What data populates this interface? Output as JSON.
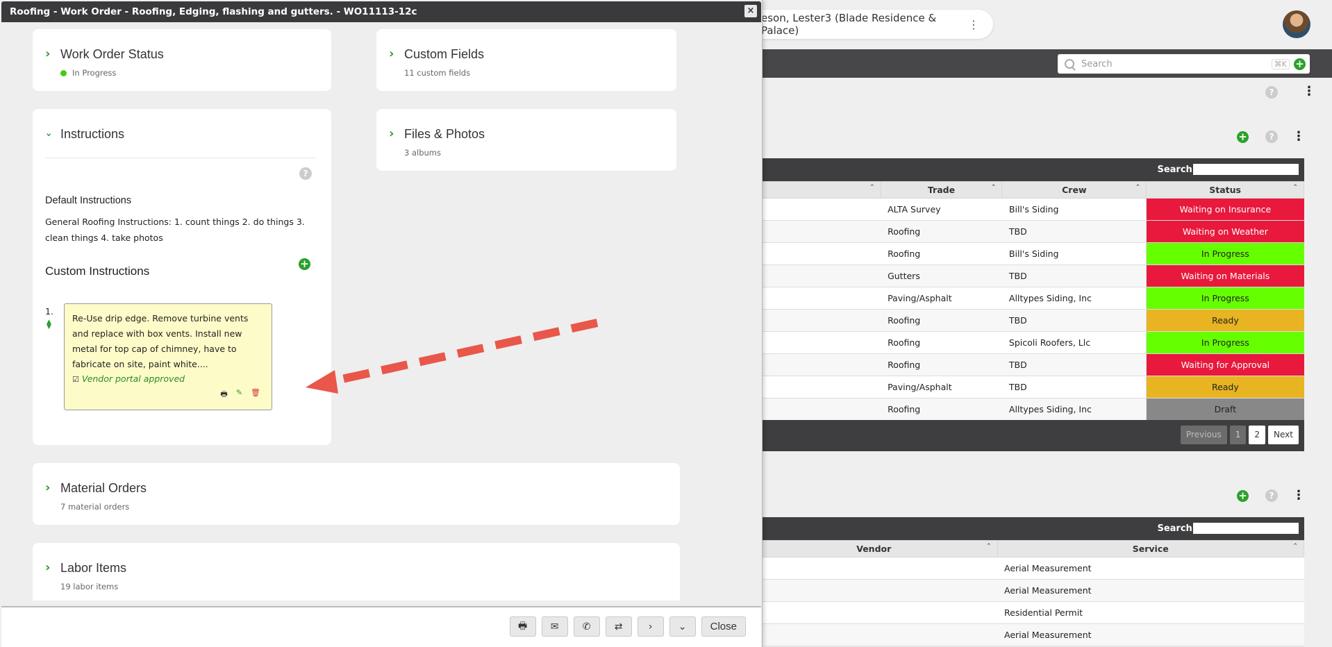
{
  "background": {
    "contact_name": "eson, Lester3 (Blade Residence & Palace)",
    "search": {
      "placeholder": "Search",
      "shortcut": "⌘K"
    },
    "table1": {
      "search_label": "Search:",
      "columns": [
        "",
        "Trade",
        "Crew",
        "Status"
      ],
      "rows": [
        {
          "trade": "ALTA Survey",
          "crew": "Bill's Siding",
          "status": "Waiting on Insurance",
          "color": "#e8193c"
        },
        {
          "trade": "Roofing",
          "crew": "TBD",
          "status": "Waiting on Weather",
          "color": "#e8193c"
        },
        {
          "trade": "Roofing",
          "crew": "Bill's Siding",
          "status": "In Progress",
          "color": "#66ff00"
        },
        {
          "trade": "Gutters",
          "crew": "TBD",
          "status": "Waiting on Materials",
          "color": "#e8193c"
        },
        {
          "trade": "Paving/Asphalt",
          "crew": "Alltypes Siding, Inc",
          "status": "In Progress",
          "color": "#66ff00"
        },
        {
          "trade": "Roofing",
          "crew": "TBD",
          "status": "Ready",
          "color": "#e8b422"
        },
        {
          "trade": "Roofing",
          "crew": "Spicoli Roofers, Llc",
          "status": "In Progress",
          "color": "#66ff00"
        },
        {
          "trade": "Roofing",
          "crew": "TBD",
          "status": "Waiting for Approval",
          "color": "#e8193c"
        },
        {
          "trade": "Paving/Asphalt",
          "crew": "TBD",
          "status": "Ready",
          "color": "#e8b422"
        },
        {
          "trade": "Roofing",
          "crew": "Alltypes Siding, Inc",
          "status": "Draft",
          "color": "#888888"
        }
      ],
      "pager": {
        "previous": "Previous",
        "page1": "1",
        "page2": "2",
        "next": "Next"
      }
    },
    "table2": {
      "search_label": "Search:",
      "columns": [
        "Vendor",
        "Service"
      ],
      "rows": [
        {
          "service": "Aerial Measurement"
        },
        {
          "service": "Aerial Measurement"
        },
        {
          "service": "Residential Permit"
        },
        {
          "service": "Aerial Measurement"
        }
      ]
    }
  },
  "modal": {
    "title": "Roofing - Work Order - Roofing, Edging, flashing and gutters. - WO11113-12c",
    "close_x": "×",
    "status_card": {
      "title": "Work Order Status",
      "value": "In Progress",
      "dot_color": "#44cc11"
    },
    "custom_fields_card": {
      "title": "Custom Fields",
      "subtitle": "11 custom fields"
    },
    "instructions_card": {
      "title": "Instructions",
      "default_title": "Default Instructions",
      "default_text": "General Roofing Instructions: 1. count things 2. do things 3. clean things 4. take photos",
      "custom_title": "Custom Instructions",
      "item_number": "1.",
      "note_text": "Re-Use drip edge. Remove turbine vents and replace with box vents. Install new metal for top cap of chimney, have to fabricate on site, paint white....",
      "note_approved": "Vendor portal approved"
    },
    "files_card": {
      "title": "Files & Photos",
      "subtitle": "3 albums"
    },
    "material_card": {
      "title": "Material Orders",
      "subtitle": "7 material orders"
    },
    "labor_card": {
      "title": "Labor Items",
      "subtitle": "19 labor items"
    },
    "footer": {
      "close_label": "Close"
    },
    "annotation_arrow_color": "#e8574a"
  }
}
